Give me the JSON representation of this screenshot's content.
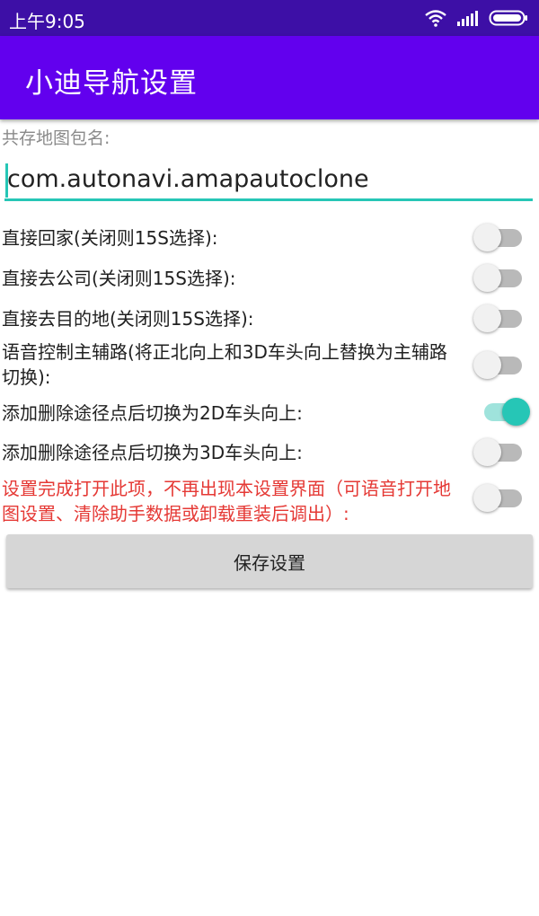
{
  "status_bar": {
    "time": "上午9:05",
    "icons": [
      "wifi-icon",
      "signal-icon",
      "battery-icon"
    ]
  },
  "app_bar": {
    "title": "小迪导航设置",
    "color": "#6200ee"
  },
  "package": {
    "label": "共存地图包名:",
    "value": "com.autonavi.amapautoclone",
    "accent": "#26c6b6"
  },
  "settings": [
    {
      "label": "直接回家(关闭则15S选择):",
      "enabled": false
    },
    {
      "label": "直接去公司(关闭则15S选择):",
      "enabled": false
    },
    {
      "label": "直接去目的地(关闭则15S选择):",
      "enabled": false
    },
    {
      "label": "语音控制主辅路(将正北向上和3D车头向上替换为主辅路切换):",
      "enabled": false
    },
    {
      "label": "添加删除途径点后切换为2D车头向上:",
      "enabled": true
    },
    {
      "label": "添加删除途径点后切换为3D车头向上:",
      "enabled": false
    },
    {
      "label": "设置完成打开此项，不再出现本设置界面（可语音打开地图设置、清除助手数据或卸载重装后调出）:",
      "enabled": false,
      "color": "#e53935"
    }
  ],
  "save_button": {
    "label": "保存设置"
  }
}
